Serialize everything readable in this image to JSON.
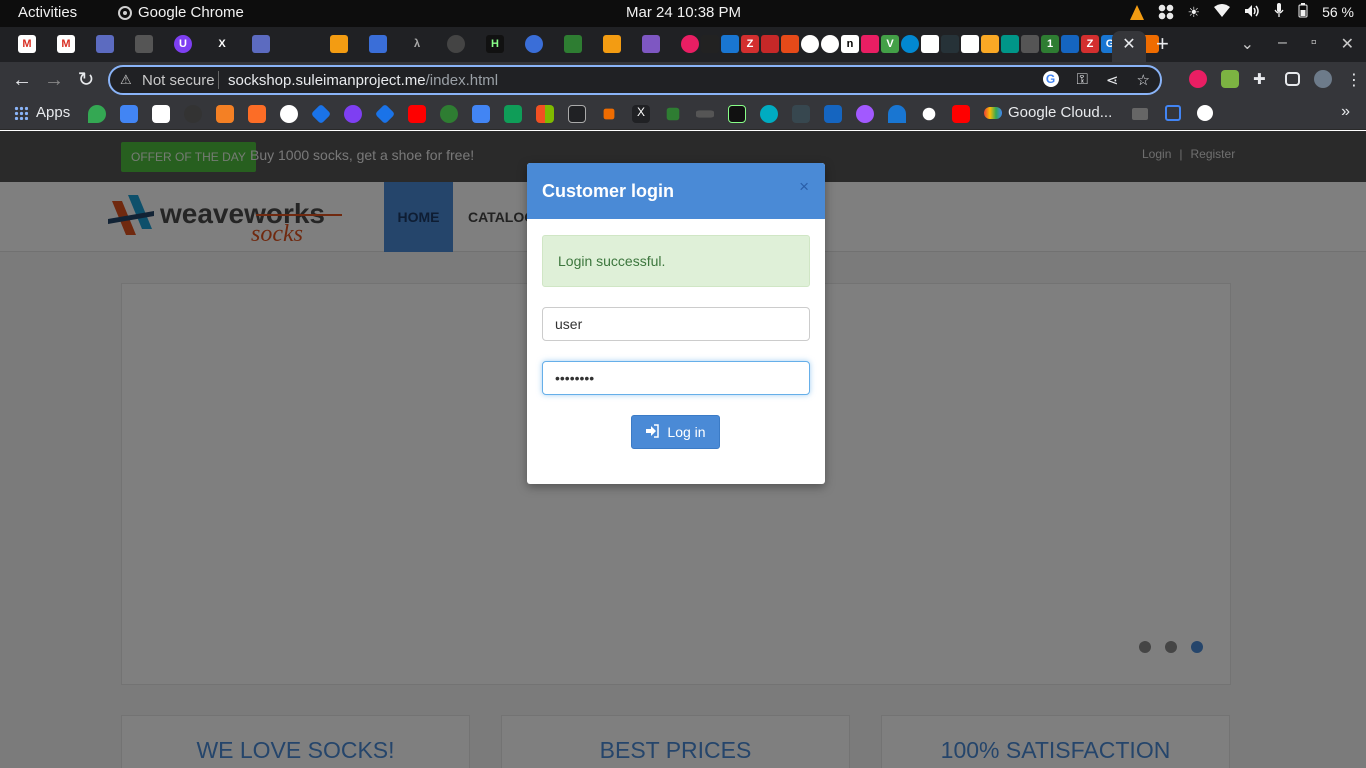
{
  "system": {
    "activities": "Activities",
    "app_name": "Google Chrome",
    "clock": "Mar 24  10:38 PM",
    "battery": "56 %"
  },
  "browser": {
    "tab_close": "✕",
    "new_tab": "+",
    "not_secure": "Not secure",
    "url_host": "sockshop.suleimanproject.me",
    "url_path": "/index.html",
    "bookmarks": {
      "apps_label": "Apps",
      "google_cloud": "Google Cloud...",
      "more": "»"
    }
  },
  "site": {
    "offer_badge": "OFFER OF THE DAY",
    "offer_text": "Buy 1000 socks, get a shoe for free!",
    "login_link": "Login",
    "separator": "|",
    "register_link": "Register",
    "logo_main": "weaveworks",
    "logo_sub": "socks",
    "nav_home": "HOME",
    "nav_catalog": "CATALOG",
    "features": [
      "WE LOVE SOCKS!",
      "BEST PRICES",
      "100% SATISFACTION"
    ]
  },
  "modal": {
    "title": "Customer login",
    "close": "×",
    "alert": "Login successful.",
    "username_value": "user",
    "password_value": "password",
    "login_button": "Log in"
  },
  "colors": {
    "accent": "#4a8ad6",
    "success_bg": "#dff0d8",
    "success_text": "#3c763d",
    "offer_green": "#4fbf3f"
  }
}
